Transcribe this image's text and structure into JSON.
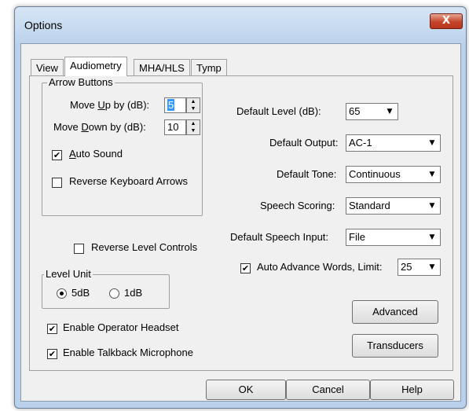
{
  "window": {
    "title": "Options",
    "close_glyph": "X"
  },
  "tabs": [
    "View",
    "Audiometry",
    "MHA/HLS",
    "Tymp"
  ],
  "active_tab": "Audiometry",
  "arrow_buttons": {
    "group_label": "Arrow Buttons",
    "move_up_label_pre": "Move ",
    "move_up_label_key": "U",
    "move_up_label_post": "p by (dB):",
    "move_up_value": "5",
    "move_down_label_pre": "Move ",
    "move_down_label_key": "D",
    "move_down_label_post": "own by (dB):",
    "move_down_value": "10",
    "auto_sound_key": "A",
    "auto_sound_rest": "uto Sound",
    "auto_sound_checked": true,
    "reverse_keyboard_label": "Reverse Keyboard Arrows",
    "reverse_keyboard_checked": false
  },
  "reverse_level": {
    "label": "Reverse Level Controls",
    "checked": false
  },
  "level_unit": {
    "group_label": "Level Unit",
    "options": [
      "5dB",
      "1dB"
    ],
    "selected": "5dB"
  },
  "enable_operator_headset": {
    "label": "Enable Operator Headset",
    "checked": true
  },
  "enable_talkback": {
    "label": "Enable Talkback Microphone",
    "checked": true
  },
  "defaults": {
    "level_label": "Default Level (dB):",
    "level_value": "65",
    "output_label": "Default Output:",
    "output_value": "AC-1",
    "tone_label": "Default Tone:",
    "tone_value": "Continuous",
    "scoring_label": "Speech Scoring:",
    "scoring_value": "Standard",
    "speech_input_label": "Default Speech Input:",
    "speech_input_value": "File"
  },
  "auto_advance": {
    "label": "Auto Advance Words, Limit:",
    "checked": true,
    "limit_value": "25"
  },
  "buttons": {
    "advanced": "Advanced",
    "transducers": "Transducers",
    "ok": "OK",
    "cancel": "Cancel",
    "help": "Help"
  },
  "glyphs": {
    "check": "✔",
    "combo_arrow": "▼",
    "spin_up": "▲",
    "spin_down": "▼"
  },
  "colors": {
    "title_bar": "#bcd3ec",
    "close_button": "#c4442b",
    "dialog_bg": "#f0f0f0"
  }
}
